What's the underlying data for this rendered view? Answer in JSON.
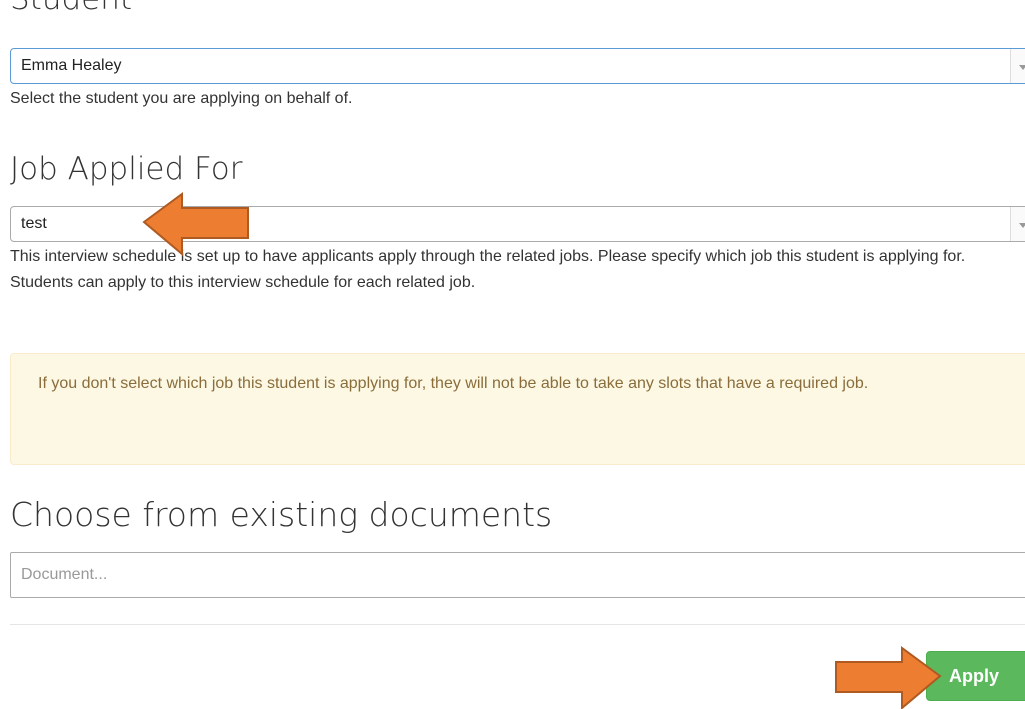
{
  "student_section": {
    "heading": "Student",
    "selected_value": "Emma Healey",
    "help_text": "Select the student you are applying on behalf of."
  },
  "job_section": {
    "heading": "Job Applied For",
    "selected_value": "test",
    "help_text": "This interview schedule is set up to have applicants apply through the related jobs. Please specify which job this student is applying for. Students can apply to this interview schedule for each related job.",
    "warning": "If you don't select which job this student is applying for, they will not be able to take any slots that have a required job."
  },
  "documents_section": {
    "heading": "Choose from existing documents",
    "placeholder": "Document..."
  },
  "actions": {
    "apply_label": "Apply"
  },
  "colors": {
    "annotation_arrow": "#ed7d31",
    "apply_button": "#5cb85c",
    "warning_background": "#fcf8e3"
  }
}
